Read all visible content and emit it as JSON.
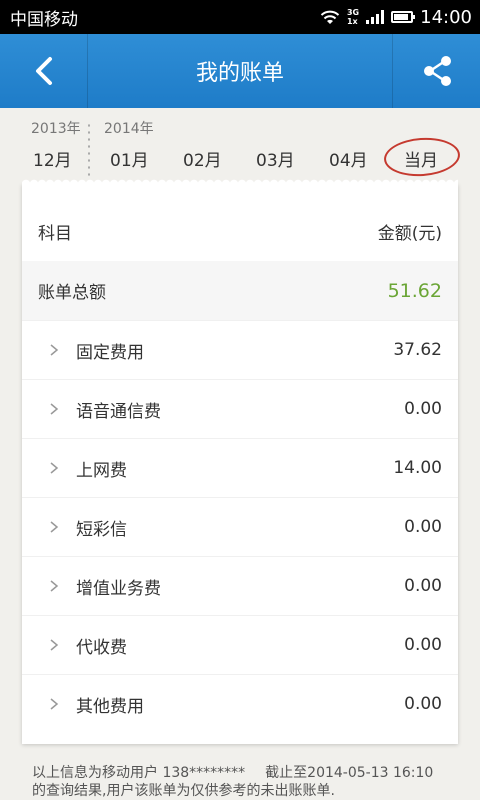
{
  "status_bar": {
    "carrier": "中国移动",
    "network_top": "3G",
    "network_bottom": "1x",
    "time": "14:00"
  },
  "header": {
    "title": "我的账单",
    "back_icon": "chevron-left-icon",
    "share_icon": "share-icon"
  },
  "month_selector": {
    "years": [
      "2013年",
      "2014年"
    ],
    "months": [
      "12月",
      "01月",
      "02月",
      "03月",
      "04月",
      "当月"
    ],
    "selected": "当月",
    "accent_color": "#c53a2f"
  },
  "bill": {
    "column_subject": "科目",
    "column_amount": "金额(元)",
    "total_label": "账单总额",
    "total_amount": "51.62",
    "total_color": "#6aa535",
    "items": [
      {
        "label": "固定费用",
        "amount": "37.62"
      },
      {
        "label": "语音通信费",
        "amount": "0.00"
      },
      {
        "label": "上网费",
        "amount": "14.00"
      },
      {
        "label": "短彩信",
        "amount": "0.00"
      },
      {
        "label": "增值业务费",
        "amount": "0.00"
      },
      {
        "label": "代收费",
        "amount": "0.00"
      },
      {
        "label": "其他费用",
        "amount": "0.00"
      }
    ]
  },
  "footer": {
    "line1_a": "以上信息为移动用户 138********",
    "line1_b": "截止至2014-05-13 16:10",
    "line2": "的查询结果,用户该账单为仅供参考的未出账账单."
  },
  "colors": {
    "header_blue": "#2385d0",
    "background": "#f1f0ec"
  }
}
